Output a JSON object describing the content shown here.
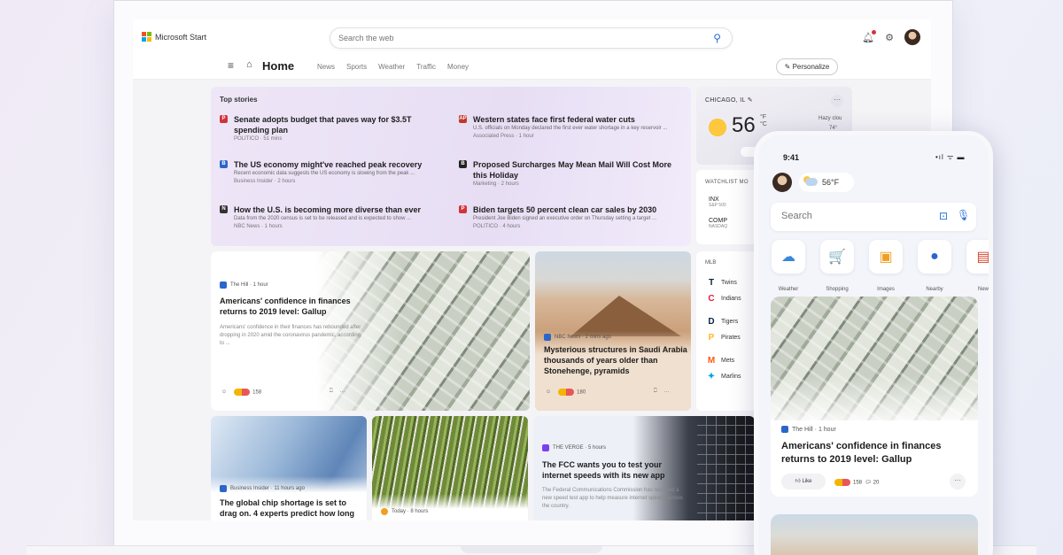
{
  "app": {
    "brand": "Microsoft Start",
    "logo_colors": [
      "#f25022",
      "#7fba00",
      "#00a4ef",
      "#ffb900"
    ]
  },
  "search": {
    "placeholder": "Search the web"
  },
  "nav": {
    "home": "Home",
    "links": [
      "News",
      "Sports",
      "Weather",
      "Traffic",
      "Money"
    ],
    "personalize": "Personalize"
  },
  "top_stories": {
    "title": "Top stories",
    "items": [
      {
        "headline": "Senate adopts budget that paves way for $3.5T spending plan",
        "snippet": "",
        "meta": "POLITICO · 51 mins",
        "icon_color": "#d13438"
      },
      {
        "headline": "Western states face first federal water cuts",
        "snippet": "U.S. officials on Monday declared the first ever water shortage in a key reservoir ...",
        "meta": "Associated Press · 1 hour",
        "icon_color": "#c0392b"
      },
      {
        "headline": "The US economy might've reached peak recovery",
        "snippet": "Recent economic data suggests the US economy is slowing from the peak ...",
        "meta": "Business Insider · 2 hours",
        "icon_color": "#2a66c9"
      },
      {
        "headline": "Proposed Surcharges May Mean Mail Will Cost More this Holiday",
        "snippet": "",
        "meta": "Marketing · 2 hours",
        "icon_color": "#222222"
      },
      {
        "headline": "How the U.S. is becoming more diverse than ever",
        "snippet": "Data from the 2020 census is set to be released and is expected to show ...",
        "meta": "NBC News · 1 hours",
        "icon_color": "#333333"
      },
      {
        "headline": "Biden targets 50 percent clean car sales by 2030",
        "snippet": "President Joe Biden signed an executive order on Thursday setting a target ...",
        "meta": "POLITICO · 4 hours",
        "icon_color": "#d13438"
      }
    ]
  },
  "weather": {
    "city": "CHICAGO, IL",
    "temp": "56",
    "unit_f": "°F",
    "unit_c": "°C",
    "condition": "Hazy clou",
    "hilo": "74°",
    "button": "S"
  },
  "watchlist": {
    "title": "WATCHLIST MO",
    "rows": [
      {
        "symbol": "INX",
        "name": "S&P 500"
      },
      {
        "symbol": "COMP",
        "name": "NASDAQ"
      }
    ]
  },
  "mlb": {
    "title": "MLB",
    "teams": [
      {
        "name": "Twins",
        "color": "#0c2340"
      },
      {
        "name": "Indians",
        "color": "#e31937"
      },
      {
        "name": "Tigers",
        "color": "#0c2340"
      },
      {
        "name": "Pirates",
        "color": "#fdb827"
      },
      {
        "name": "Mets",
        "color": "#ff5910"
      },
      {
        "name": "Marlins",
        "color": "#00a3e0"
      }
    ]
  },
  "cards": {
    "gallup": {
      "source": "The Hill · 1 hour",
      "headline": "Americans' confidence in finances returns to 2019 level: Gallup",
      "snippet": "Americans' confidence in their finances has rebounded after dropping in 2020 amid the coronavirus pandemic, according to ...",
      "reactions": "158"
    },
    "saudi": {
      "source": "NBC News · 2 mins ago",
      "headline": "Mysterious structures in Saudi Arabia thousands of years older than Stonehenge, pyramids",
      "reactions": "180"
    },
    "chip": {
      "source": "Business Insider · 11 hours ago",
      "headline": "The global chip shortage is set to drag on. 4 experts predict how long"
    },
    "asparagus": {
      "source": "Today · 8 hours"
    },
    "fcc": {
      "source": "THE VERGE · 5 hours",
      "headline": "The FCC wants you to test your internet speeds with its new app",
      "snippet": "The Federal Communications Commission has released a new speed test app to help measure internet speeds across the country."
    }
  },
  "phone": {
    "time": "9:41",
    "status": "•ıl ᯤ ▬",
    "weather": "56°F",
    "search": "Search",
    "apps": [
      {
        "label": "Weather",
        "glyph": "☁",
        "color": "#3a86d8"
      },
      {
        "label": "Shopping",
        "glyph": "🛒",
        "color": "#e8405a"
      },
      {
        "label": "Images",
        "glyph": "▣",
        "color": "#f0a020"
      },
      {
        "label": "Nearby",
        "glyph": "●",
        "color": "#2a66c9"
      },
      {
        "label": "New",
        "glyph": "▤",
        "color": "#d9432c"
      }
    ],
    "card": {
      "source": "The Hill · 1 hour",
      "headline": "Americans' confidence in finances returns to 2019 level: Gallup",
      "like": "Like",
      "reactions": "158",
      "comments": "20"
    }
  }
}
